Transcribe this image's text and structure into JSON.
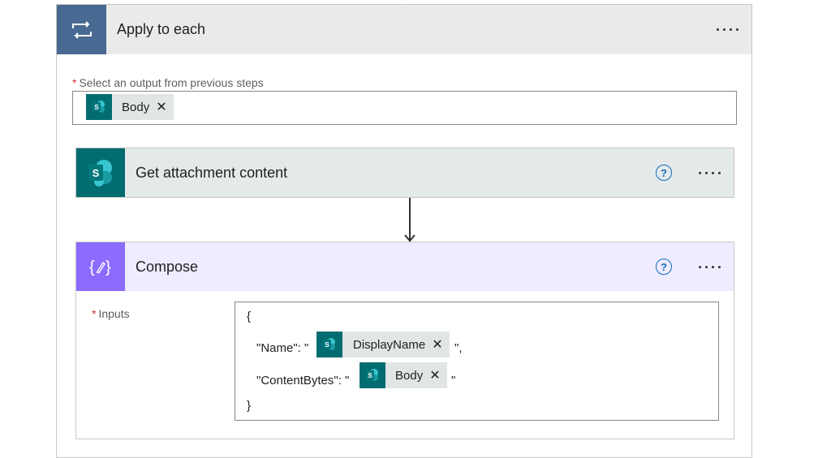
{
  "apply_to_each": {
    "title": "Apply to each",
    "select_label": "Select an output from previous steps",
    "required_mark": "*",
    "token": {
      "label": "Body",
      "icon": "sharepoint-icon"
    }
  },
  "get_attachment": {
    "title": "Get attachment content",
    "help": "?",
    "icon": "sharepoint-icon"
  },
  "compose": {
    "title": "Compose",
    "help": "?",
    "inputs_label": "Inputs",
    "required_mark": "*",
    "code": {
      "open_brace": "{",
      "name_key": "\"Name\": \"",
      "name_suffix": "\",",
      "name_token": "DisplayName",
      "content_key": "\"ContentBytes\": \"",
      "content_suffix": "\"",
      "content_token": "Body",
      "close_brace": "}"
    }
  },
  "colors": {
    "loop_header": "#486991",
    "sharepoint": "#036c70",
    "compose": "#8c6cff",
    "required": "#d13438",
    "help_blue": "#0f6cbd"
  }
}
